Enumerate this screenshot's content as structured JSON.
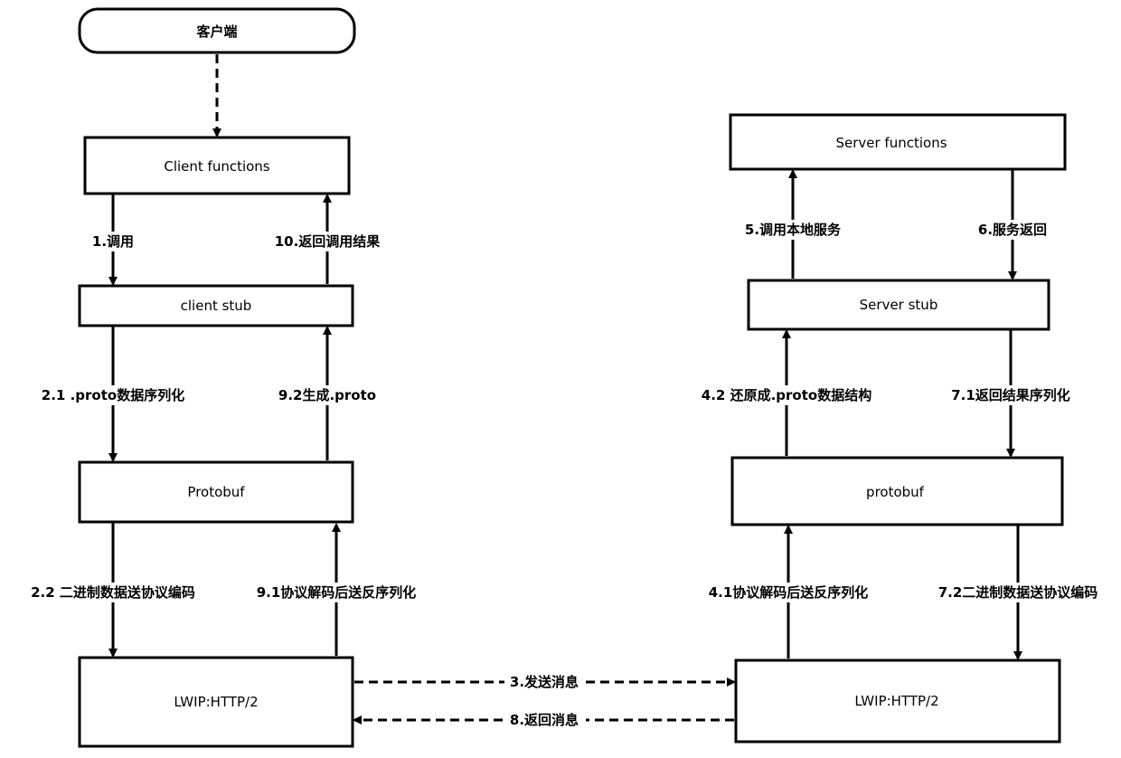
{
  "title_node": {
    "label": "客户端"
  },
  "client": {
    "functions": "Client functions",
    "stub": "client stub",
    "protobuf": "Protobuf",
    "transport": "LWIP:HTTP/2"
  },
  "server": {
    "functions": "Server functions",
    "stub": "Server stub",
    "protobuf": "protobuf",
    "transport": "LWIP:HTTP/2"
  },
  "edges": {
    "e1": "1.调用",
    "e10": "10.返回调用结果",
    "e2_1": "2.1 .proto数据序列化",
    "e9_2": "9.2生成.proto",
    "e2_2": "2.2 二进制数据送协议编码",
    "e9_1": "9.1协议解码后送反序列化",
    "e3": "3.发送消息",
    "e8": "8.返回消息",
    "e4_1": "4.1协议解码后送反序列化",
    "e7_2": "7.2二进制数据送协议编码",
    "e4_2": "4.2 还原成.proto数据结构",
    "e7_1": "7.1返回结果序列化",
    "e5": "5.调用本地服务",
    "e6": "6.服务返回"
  }
}
